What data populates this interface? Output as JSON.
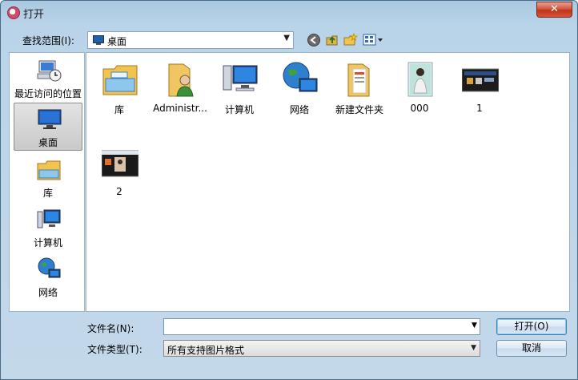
{
  "window": {
    "title": "打开",
    "close_glyph": "✕"
  },
  "toolbar": {
    "look_in_label": "查找范围(I):",
    "look_in_value": "桌面",
    "icons": [
      "back-icon",
      "up-folder-icon",
      "new-folder-icon",
      "view-menu-icon"
    ]
  },
  "places": [
    {
      "label": "最近访问的位置",
      "icon": "recent-places-icon"
    },
    {
      "label": "桌面",
      "icon": "desktop-icon",
      "selected": true
    },
    {
      "label": "库",
      "icon": "libraries-icon"
    },
    {
      "label": "计算机",
      "icon": "computer-icon"
    },
    {
      "label": "网络",
      "icon": "network-icon"
    }
  ],
  "items": [
    {
      "label": "库",
      "icon": "libraries-icon"
    },
    {
      "label": "Administr...",
      "icon": "user-folder-icon"
    },
    {
      "label": "计算机",
      "icon": "computer-icon"
    },
    {
      "label": "网络",
      "icon": "network-icon"
    },
    {
      "label": "新建文件夹",
      "icon": "folder-icon"
    },
    {
      "label": "000",
      "icon": "image-thumbnail-icon"
    },
    {
      "label": "1",
      "icon": "image-thumbnail-icon"
    },
    {
      "label": "2",
      "icon": "image-thumbnail-icon"
    }
  ],
  "form": {
    "filename_label": "文件名(N):",
    "filename_value": "",
    "filetype_label": "文件类型(T):",
    "filetype_value": "所有支持图片格式",
    "dropdown_glyph": "▼"
  },
  "buttons": {
    "open": "打开(O)",
    "cancel": "取消"
  },
  "colors": {
    "close_red": "#c0331a",
    "accent_blue": "#3c7fb1",
    "folder_yellow": "#f2c44f"
  }
}
